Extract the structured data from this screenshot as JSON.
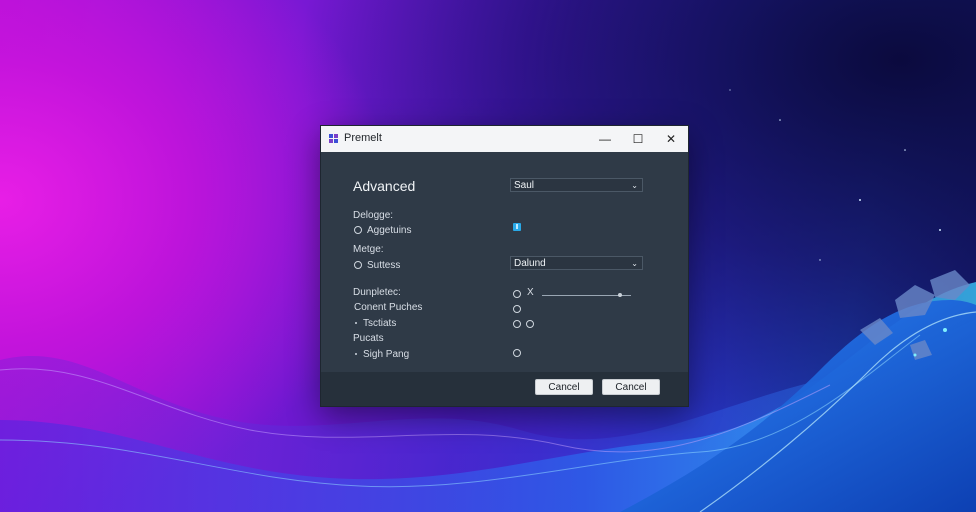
{
  "window": {
    "title": "Premelt",
    "minimize_glyph": "—",
    "maximize_glyph": "☐",
    "close_glyph": "✕"
  },
  "dialog": {
    "heading": "Advanced",
    "top_select_value": "Saul",
    "section_1_label": "Delogge:",
    "option_1_label": "Aggetuins",
    "section_2_label": "Metge:",
    "option_2_label": "Suttess",
    "middle_select_value": "Dalund",
    "section_3_label": "Dunpletec:",
    "item_content_label": "Conent Puches",
    "item_tsctiats_label": "Tsctiats",
    "section_4_label": "Pucats",
    "item_sigh_label": "Sigh Pang",
    "x_mark": "X",
    "chevron": "⌄"
  },
  "footer": {
    "cancel_1_label": "Cancel",
    "cancel_2_label": "Cancel"
  },
  "colors": {
    "dialog_bg": "#2f3a47",
    "titlebar_bg": "#f4f5f7",
    "accent_checkbox": "#29a9e8",
    "icon_blue": "#3b4fd6",
    "icon_purple": "#7a3ec8"
  }
}
